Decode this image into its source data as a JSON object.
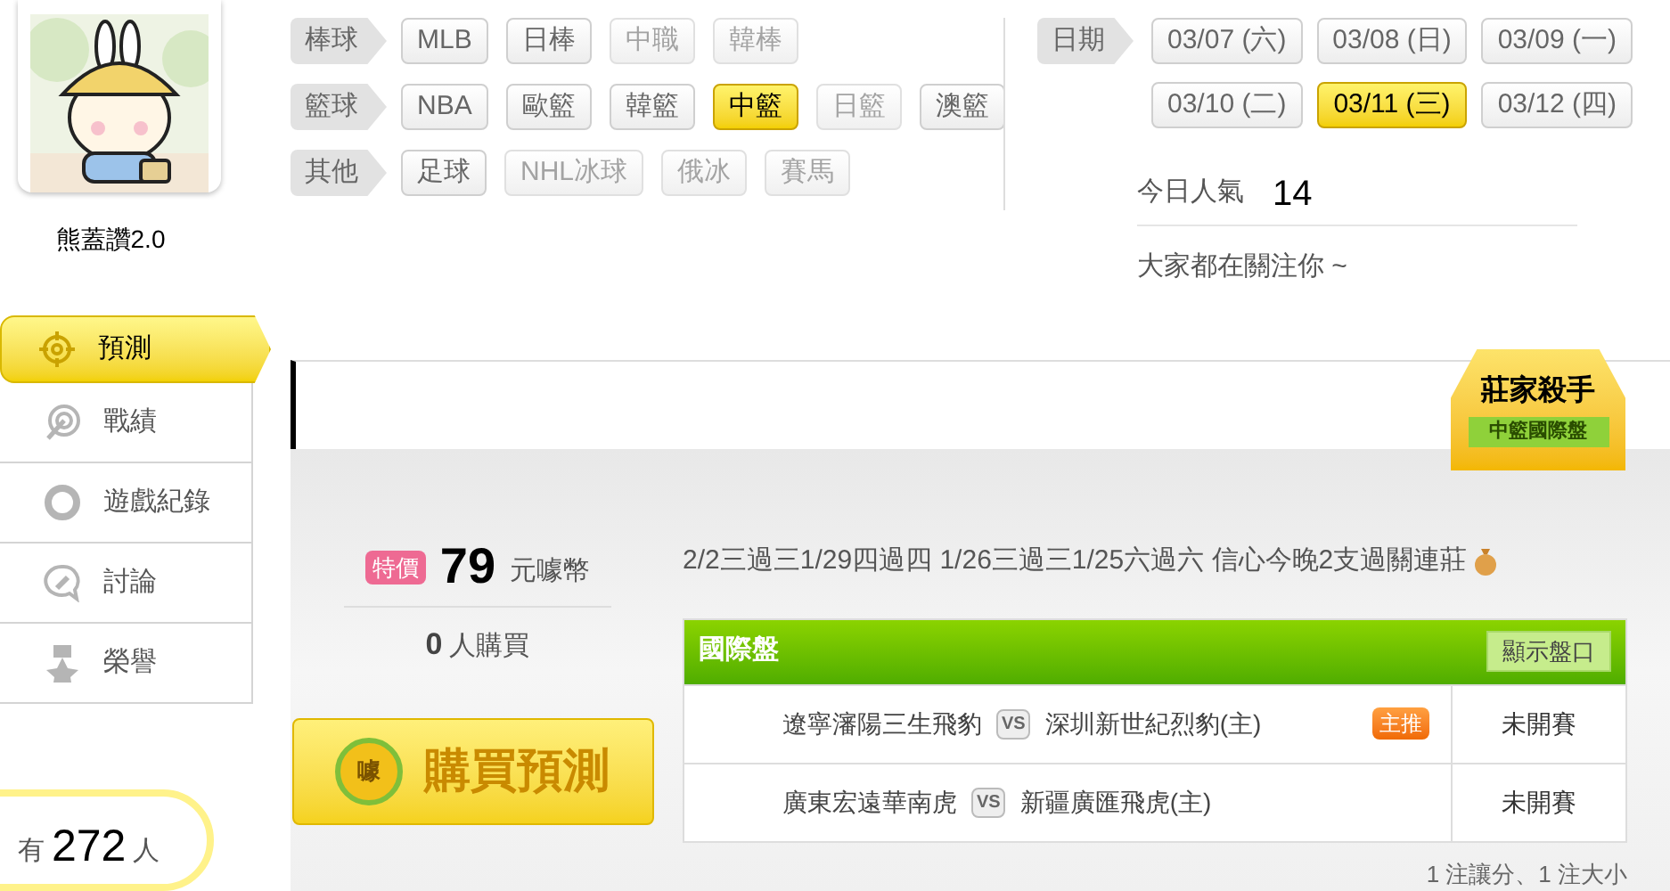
{
  "user": {
    "name": "熊蓋讚2.0"
  },
  "menu": [
    {
      "label": "預測",
      "selected": true,
      "kind": "target"
    },
    {
      "label": "戰績",
      "selected": false,
      "kind": "record"
    },
    {
      "label": "遊戲紀錄",
      "selected": false,
      "kind": "ring"
    },
    {
      "label": "討論",
      "selected": false,
      "kind": "chat"
    },
    {
      "label": "榮譽",
      "selected": false,
      "kind": "medal"
    }
  ],
  "online": {
    "prefix": "有",
    "count": "272",
    "suffix": "人"
  },
  "sports": [
    {
      "label": "棒球",
      "tags": [
        {
          "label": "MLB",
          "selected": false,
          "disabled": false
        },
        {
          "label": "日棒",
          "selected": false,
          "disabled": false
        },
        {
          "label": "中職",
          "selected": false,
          "disabled": true
        },
        {
          "label": "韓棒",
          "selected": false,
          "disabled": true
        }
      ]
    },
    {
      "label": "籃球",
      "tags": [
        {
          "label": "NBA",
          "selected": false,
          "disabled": false
        },
        {
          "label": "歐籃",
          "selected": false,
          "disabled": false
        },
        {
          "label": "韓籃",
          "selected": false,
          "disabled": false
        },
        {
          "label": "中籃",
          "selected": true,
          "disabled": false
        },
        {
          "label": "日籃",
          "selected": false,
          "disabled": true
        },
        {
          "label": "澳籃",
          "selected": false,
          "disabled": false
        }
      ]
    },
    {
      "label": "其他",
      "tags": [
        {
          "label": "足球",
          "selected": false,
          "disabled": false
        },
        {
          "label": "NHL冰球",
          "selected": false,
          "disabled": true
        },
        {
          "label": "俄冰",
          "selected": false,
          "disabled": true
        },
        {
          "label": "賽馬",
          "selected": false,
          "disabled": true
        }
      ]
    }
  ],
  "dates": {
    "label": "日期",
    "items": [
      {
        "label": "03/07 (六)",
        "selected": false
      },
      {
        "label": "03/08 (日)",
        "selected": false
      },
      {
        "label": "03/09 (一)",
        "selected": false
      },
      {
        "label": "03/10 (二)",
        "selected": false
      },
      {
        "label": "03/11 (三)",
        "selected": true
      },
      {
        "label": "03/12 (四)",
        "selected": false
      }
    ]
  },
  "popularity": {
    "label": "今日人氣",
    "value": "14",
    "note": "大家都在關注你 ~"
  },
  "badge": {
    "title": "莊家殺手",
    "subtitle": "中籃國際盤"
  },
  "offer": {
    "tag": "特價",
    "price": "79",
    "unit": "元噱幣",
    "buyers": "0",
    "buyers_label": "人購買",
    "button": "購買預測",
    "coin": "噱"
  },
  "headline": "2/2三過三1/29四過四 1/26三過三1/25六過六 信心今晚2支過關連莊",
  "table": {
    "title": "國際盤",
    "toggle": "顯示盤口",
    "rows": [
      {
        "vs": "VS",
        "away": "遼寧瀋陽三生飛豹",
        "home": "深圳新世紀烈豹(主)",
        "tag": "主推",
        "status": "未開賽"
      },
      {
        "vs": "VS",
        "away": "廣東宏遠華南虎",
        "home": "新疆廣匯飛虎(主)",
        "status": "未開賽"
      }
    ]
  },
  "footer": "1 注讓分、1 注大小"
}
